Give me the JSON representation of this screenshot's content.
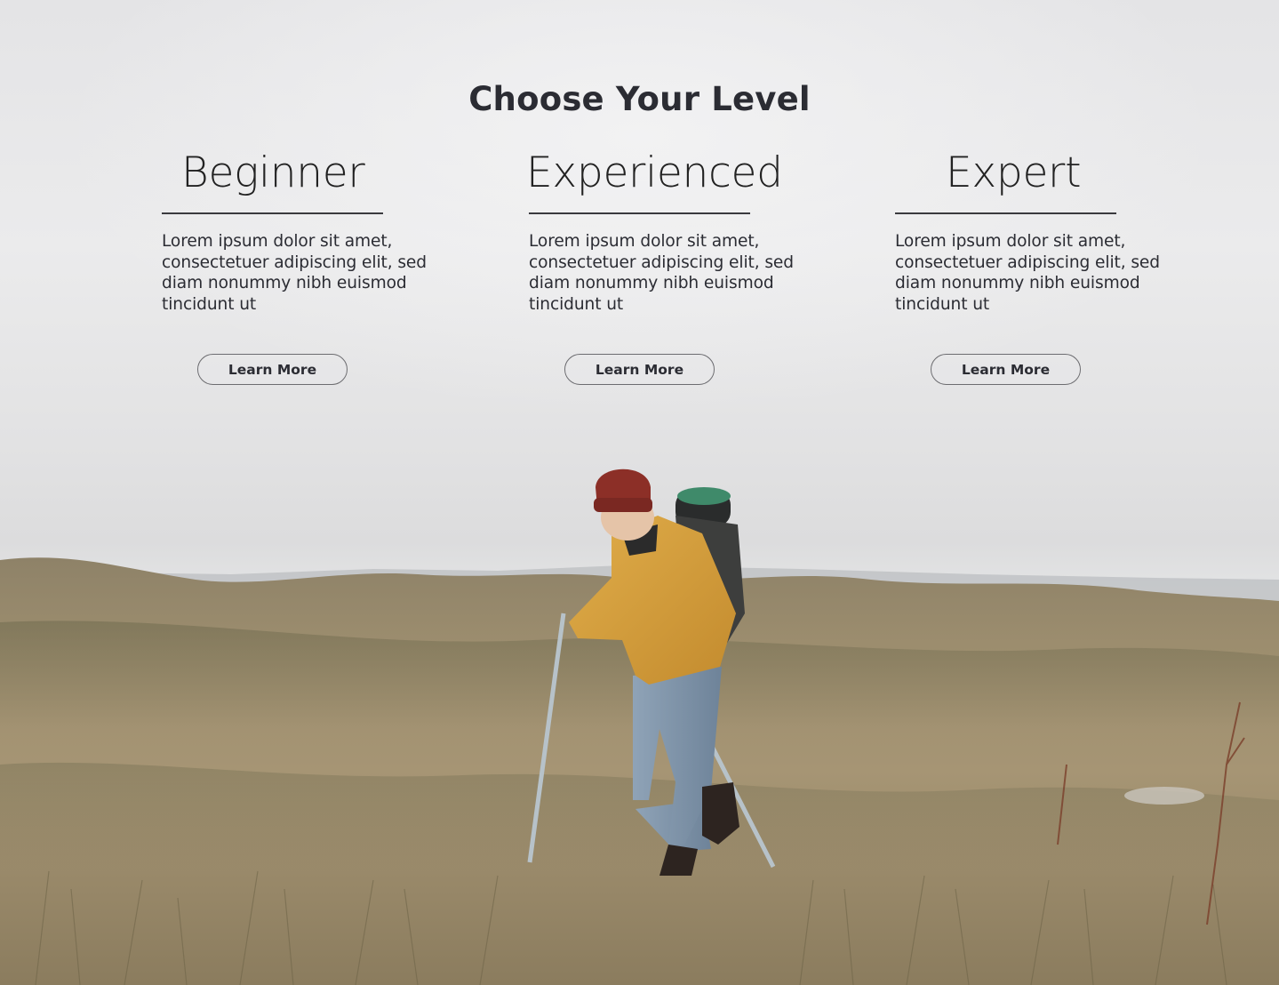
{
  "page": {
    "title": "Choose Your Level"
  },
  "levels": [
    {
      "name": "Beginner",
      "description": "Lorem ipsum dolor sit amet, consectetuer adipiscing elit, sed diam nonummy nibh euismod tincidunt ut",
      "button_label": "Learn More"
    },
    {
      "name": "Experienced",
      "description": "Lorem ipsum dolor sit amet, consectetuer adipiscing elit, sed diam nonummy nibh euismod tincidunt ut",
      "button_label": "Learn More"
    },
    {
      "name": "Expert",
      "description": "Lorem ipsum dolor sit amet, consectetuer adipiscing elit, sed diam nonummy nibh euismod tincidunt ut",
      "button_label": "Learn More"
    }
  ],
  "colors": {
    "text": "#2b2c33",
    "sky": "#e6e6e7",
    "grass": "#a08f6c",
    "jacket": "#d6a23e",
    "beanie": "#8c2f27"
  },
  "background": {
    "scene": "hiker-in-grass-field-photo"
  }
}
